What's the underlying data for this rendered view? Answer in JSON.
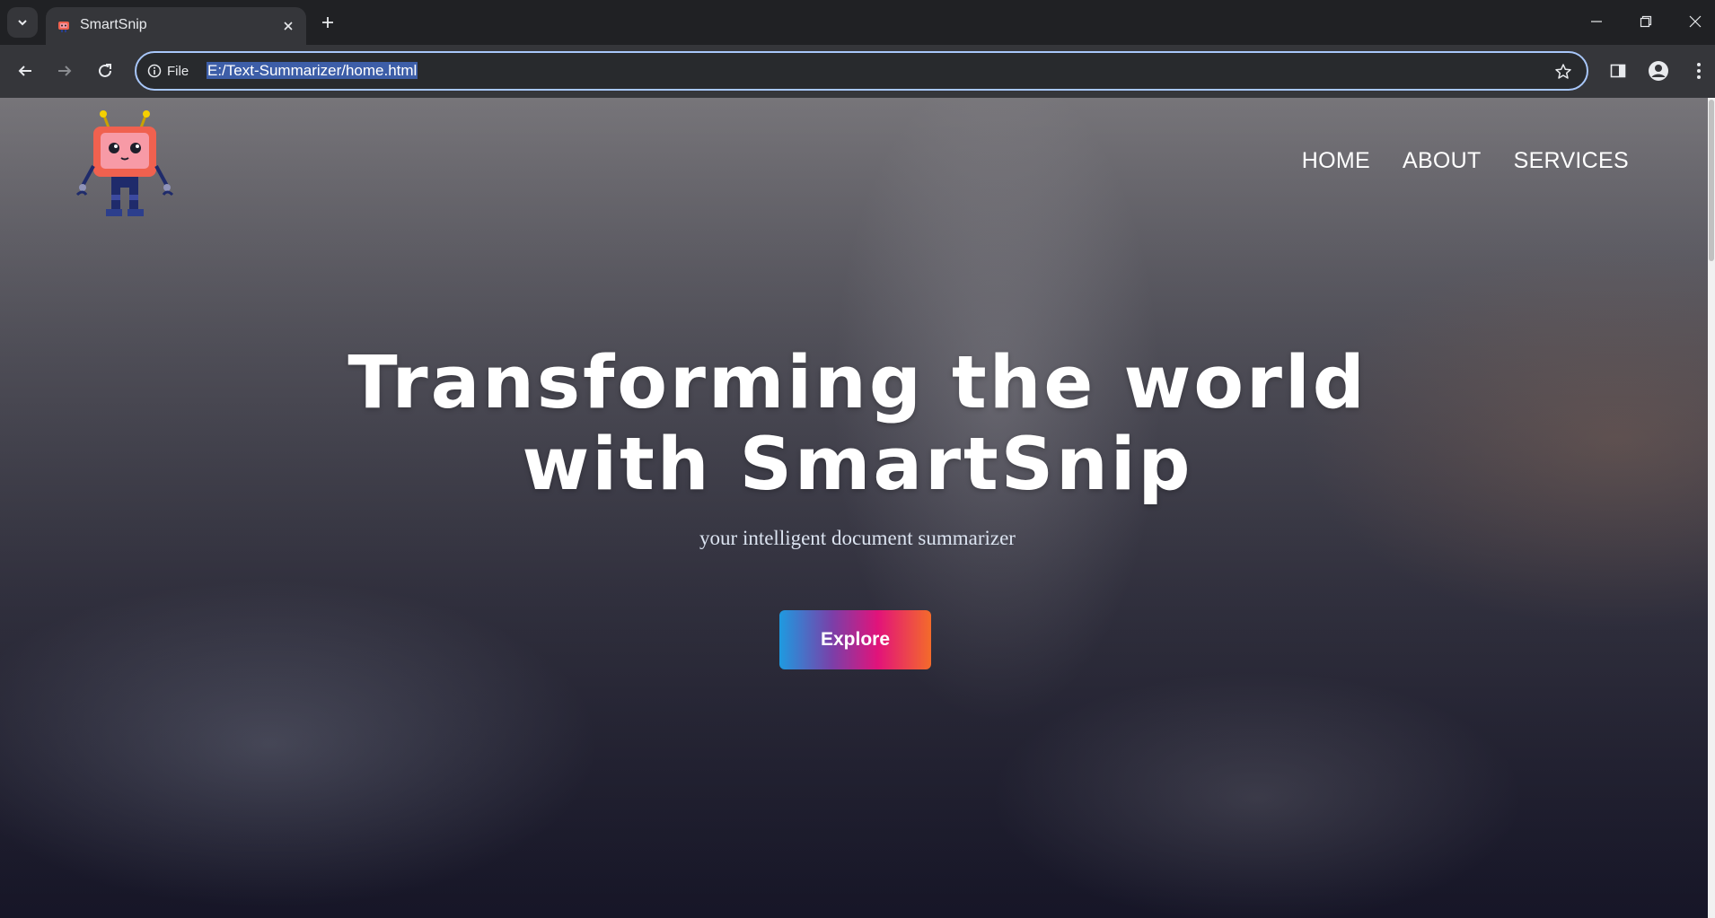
{
  "browser": {
    "tab": {
      "title": "SmartSnip"
    },
    "address_bar": {
      "scheme_label": "File",
      "url": "E:/Text-Summarizer/home.html"
    }
  },
  "page": {
    "nav": {
      "home": "HOME",
      "about": "ABOUT",
      "services": "SERVICES"
    },
    "hero": {
      "title_line1": "Transforming the world",
      "title_line2": "with SmartSnip",
      "subtitle": "your intelligent document summarizer",
      "cta": "Explore"
    }
  },
  "colors": {
    "browser_frame": "#202124",
    "toolbar": "#35363a",
    "omnibox_focus": "#a8c7fa",
    "cta_gradient": [
      "#1e9ae0",
      "#7b3fa8",
      "#e2137a",
      "#f46b2a"
    ]
  },
  "icons": [
    "tab-search-icon",
    "robot-favicon-icon",
    "close-icon",
    "plus-icon",
    "minimize-icon",
    "restore-icon",
    "close-window-icon",
    "back-arrow-icon",
    "forward-arrow-icon",
    "reload-icon",
    "info-icon",
    "star-icon",
    "side-panel-icon",
    "profile-icon",
    "kebab-menu-icon",
    "robot-logo"
  ]
}
